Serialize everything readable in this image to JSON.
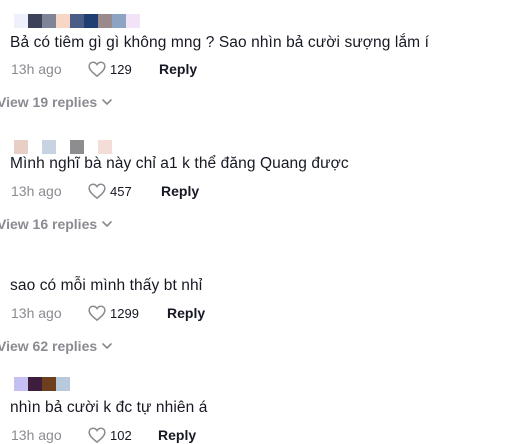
{
  "comments": [
    {
      "text": "Bả có tiêm gì gì không mng ? Sao nhìn bả cười sượng lắm í",
      "time": "13h ago",
      "likes": "129",
      "reply": "Reply",
      "view_replies": "View 19 replies",
      "name_colors": [
        "#eef0fb",
        "#3c4257",
        "#7d8597",
        "#f8d6c6",
        "#4a5d86",
        "#1f3f73",
        "#9a8a8c",
        "#8da3c4",
        "#f3e3f8"
      ]
    },
    {
      "text": "Mình nghĩ bà này chỉ a1 k thể đăng Quang được",
      "time": "13h ago",
      "likes": "457",
      "reply": "Reply",
      "view_replies": "View 16 replies",
      "name_colors": [
        "#e8cfc6",
        "#ffffff",
        "#c7d3e2",
        "#ffffff",
        "#8d8d8f",
        "#ffffff",
        "#f4ddd6"
      ]
    },
    {
      "text": "sao có mỗi mình thấy bt nhỉ",
      "time": "13h ago",
      "likes": "1299",
      "reply": "Reply",
      "view_replies": "View 62 replies",
      "name_colors": []
    },
    {
      "text": "nhìn bả cười k đc tự nhiên á",
      "time": "13h ago",
      "likes": "102",
      "reply": "Reply",
      "name_colors": [
        "#c4c0f2",
        "#3f1d3d",
        "#6e3f1d",
        "#b9c9dc"
      ]
    }
  ]
}
